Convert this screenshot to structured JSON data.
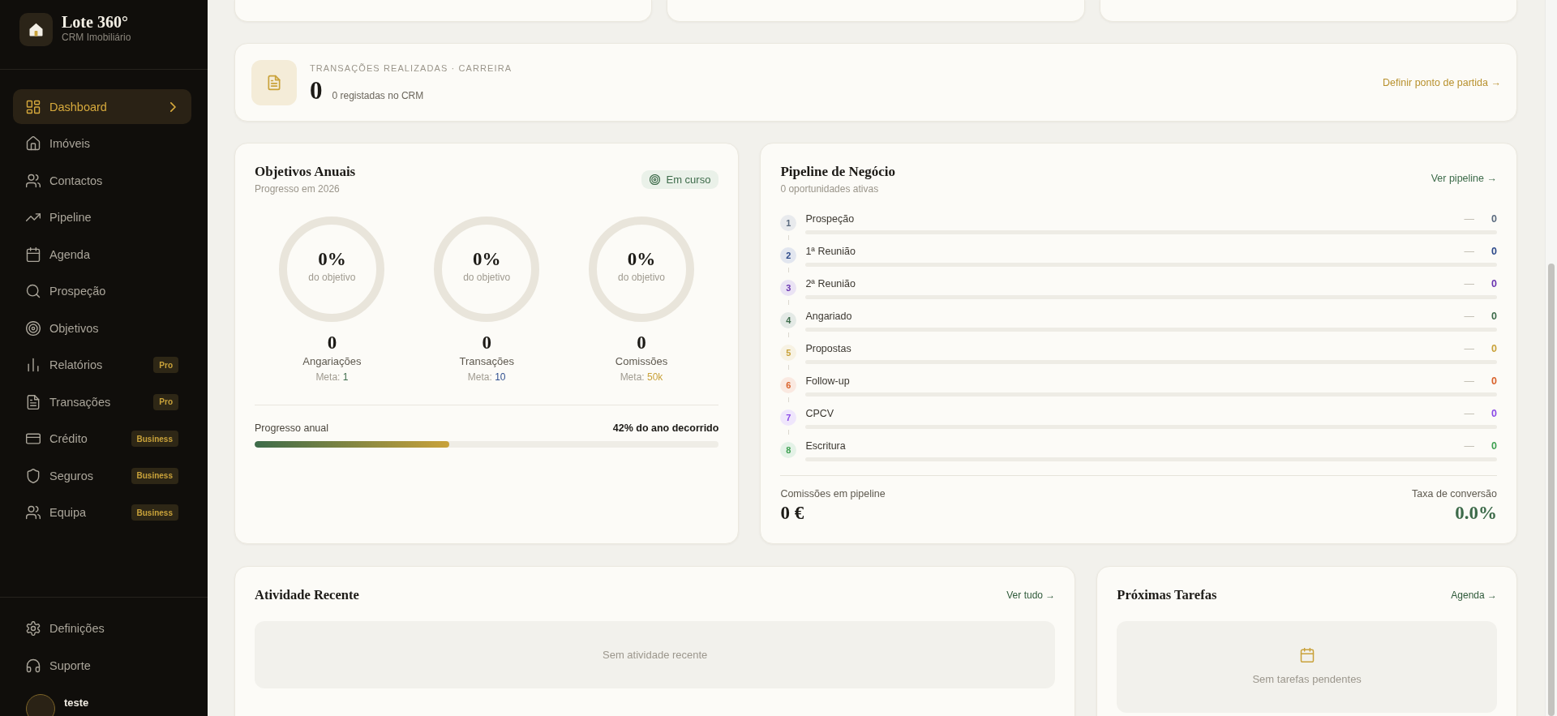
{
  "sidebar": {
    "brand": {
      "name": "Lote 360°",
      "tagline": "CRM Imobiliário"
    },
    "nav": [
      {
        "label": "Dashboard",
        "selected": true
      },
      {
        "label": "Imóveis",
        "selected": false
      },
      {
        "label": "Contactos",
        "selected": false
      },
      {
        "label": "Pipeline",
        "selected": false
      },
      {
        "label": "Agenda",
        "selected": false
      },
      {
        "label": "Prospeção",
        "selected": false
      },
      {
        "label": "Objetivos",
        "selected": false
      },
      {
        "label": "Relatórios",
        "selected": false,
        "badge": "Pro"
      },
      {
        "label": "Transações",
        "selected": false,
        "badge": "Pro"
      },
      {
        "label": "Crédito",
        "selected": false,
        "badge": "Business"
      },
      {
        "label": "Seguros",
        "selected": false,
        "badge": "Business"
      },
      {
        "label": "Equipa",
        "selected": false,
        "badge": "Business"
      }
    ],
    "footer_nav": [
      {
        "label": "Definições"
      },
      {
        "label": "Suporte"
      }
    ],
    "user": {
      "name": "teste"
    }
  },
  "career_transactions": {
    "label": "TRANSAÇÕES REALIZADAS · CARREIRA",
    "count": "0",
    "note": "0 registadas no CRM",
    "link": "Definir ponto de partida →"
  },
  "annual_goals": {
    "title": "Objetivos Anuais",
    "subtitle": "Progresso em 2026",
    "status": "Em curso",
    "goals": [
      {
        "percent": "0%",
        "caption": "do objetivo",
        "value": "0",
        "label": "Angariações",
        "target_label": "Meta:",
        "target": "1",
        "color": "#3d6b4a",
        "level": 0
      },
      {
        "percent": "0%",
        "caption": "do objetivo",
        "value": "0",
        "label": "Transações",
        "target_label": "Meta:",
        "target": "10",
        "color": "#2f4f8f",
        "level": 0
      },
      {
        "percent": "0%",
        "caption": "do objetivo",
        "value": "0",
        "label": "Comissões",
        "target_label": "Meta:",
        "target": "50k",
        "color": "#c9a23a",
        "level": 0
      }
    ],
    "year_progress": {
      "label": "Progresso anual",
      "reading": "42% do ano decorrido",
      "level": 0.42
    }
  },
  "pipeline": {
    "title": "Pipeline de Negócio",
    "subtitle": "0 oportunidades ativas",
    "link": "Ver pipeline →",
    "stages": [
      {
        "number": "1",
        "name": "Prospeção",
        "value": "—",
        "count": "0",
        "color": "#5b6b7f",
        "level": 0
      },
      {
        "number": "2",
        "name": "1ª Reunião",
        "value": "—",
        "count": "0",
        "color": "#2d4a8a",
        "level": 0
      },
      {
        "number": "3",
        "name": "2ª Reunião",
        "value": "—",
        "count": "0",
        "color": "#6b35b0",
        "level": 0
      },
      {
        "number": "4",
        "name": "Angariado",
        "value": "—",
        "count": "0",
        "color": "#3d6b4a",
        "level": 0
      },
      {
        "number": "5",
        "name": "Propostas",
        "value": "—",
        "count": "0",
        "color": "#c9a23a",
        "level": 0
      },
      {
        "number": "6",
        "name": "Follow-up",
        "value": "—",
        "count": "0",
        "color": "#d9622b",
        "level": 0
      },
      {
        "number": "7",
        "name": "CPCV",
        "value": "—",
        "count": "0",
        "color": "#8b4ae6",
        "level": 0
      },
      {
        "number": "8",
        "name": "Escritura",
        "value": "—",
        "count": "0",
        "color": "#3fa152",
        "level": 0
      }
    ],
    "summary": [
      {
        "label": "Comissões em pipeline",
        "value": "0 €"
      },
      {
        "label": "Taxa de conversão",
        "value": "0.0%"
      }
    ]
  },
  "recent_activity": {
    "title": "Atividade Recente",
    "link": "Ver tudo →",
    "empty": "Sem atividade recente"
  },
  "upcoming_tasks": {
    "title": "Próximas Tarefas",
    "link": "Agenda →",
    "empty": "Sem tarefas pendentes"
  }
}
